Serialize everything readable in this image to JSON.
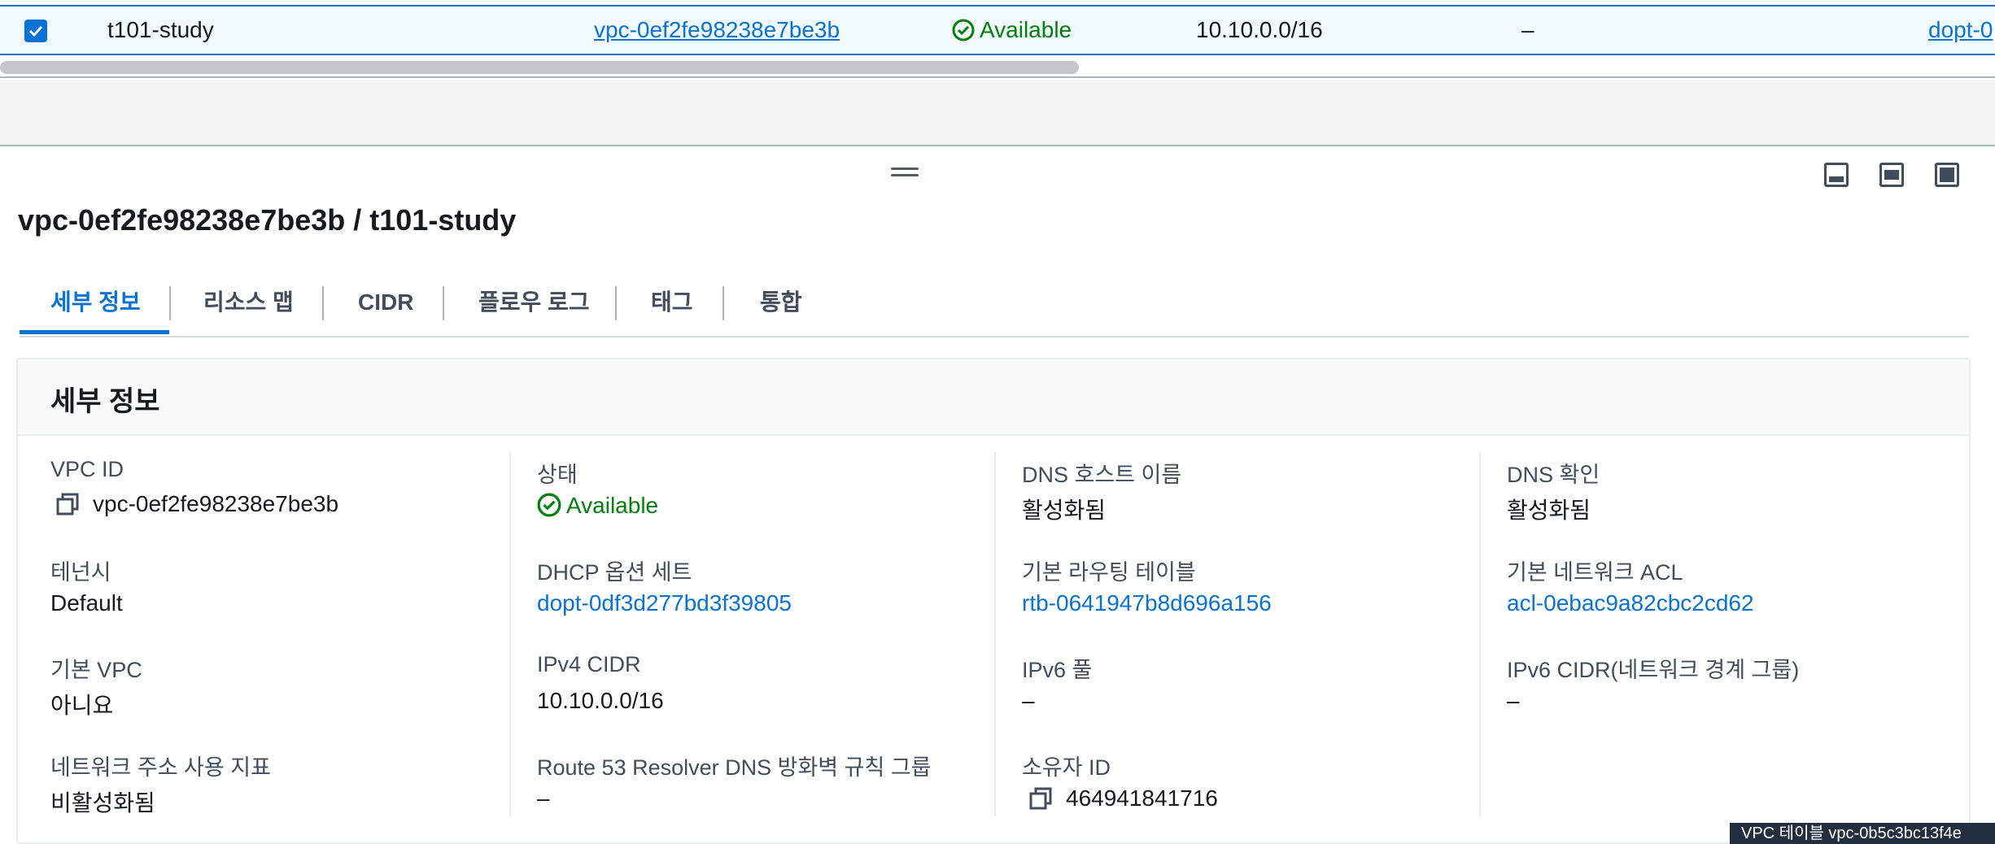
{
  "table_row": {
    "name": "t101-study",
    "vpc_id": "vpc-0ef2fe98238e7be3b",
    "state": "Available",
    "ipv4_cidr": "10.10.0.0/16",
    "ipv6_cidr": "–",
    "dhcp_options": "dopt-0"
  },
  "panel": {
    "title": "vpc-0ef2fe98238e7be3b / t101-study",
    "tabs": [
      "세부 정보",
      "리소스 맵",
      "CIDR",
      "플로우 로그",
      "태그",
      "통합"
    ],
    "active_tab": "세부 정보",
    "details_heading": "세부 정보"
  },
  "details": {
    "vpc_id": {
      "label": "VPC ID",
      "value": "vpc-0ef2fe98238e7be3b"
    },
    "tenancy": {
      "label": "테넌시",
      "value": "Default"
    },
    "default_vpc": {
      "label": "기본 VPC",
      "value": "아니요"
    },
    "net_addr_usage": {
      "label": "네트워크 주소 사용 지표",
      "value": "비활성화됨"
    },
    "state": {
      "label": "상태",
      "value": "Available"
    },
    "dhcp": {
      "label": "DHCP 옵션 세트",
      "value": "dopt-0df3d277bd3f39805"
    },
    "ipv4_cidr": {
      "label": "IPv4 CIDR",
      "value": "10.10.0.0/16"
    },
    "route53": {
      "label": "Route 53 Resolver DNS 방화벽 규칙 그룹",
      "value": "–"
    },
    "dns_hostnames": {
      "label": "DNS 호스트 이름",
      "value": "활성화됨"
    },
    "main_route_table": {
      "label": "기본 라우팅 테이블",
      "value": "rtb-0641947b8d696a156"
    },
    "ipv6_pool": {
      "label": "IPv6 풀",
      "value": "–"
    },
    "owner_id": {
      "label": "소유자 ID",
      "value": "464941841716"
    },
    "dns_resolution": {
      "label": "DNS 확인",
      "value": "활성화됨"
    },
    "main_nacl": {
      "label": "기본 네트워크 ACL",
      "value": "acl-0ebac9a82cbc2cd62"
    },
    "ipv6_cidr_group": {
      "label": "IPv6 CIDR(네트워크 경계 그룹)",
      "value": "–"
    }
  },
  "tooltip": "VPC 테이블 vpc-0b5c3bc13f4e",
  "colors": {
    "link": "#0972d3",
    "success": "#037f0c",
    "text": "#16191f"
  },
  "icons": [
    "checkbox-checked-icon",
    "status-available-icon",
    "drag-handle-icon",
    "panel-bottom-icon",
    "panel-side-icon",
    "panel-full-icon",
    "copy-icon"
  ]
}
